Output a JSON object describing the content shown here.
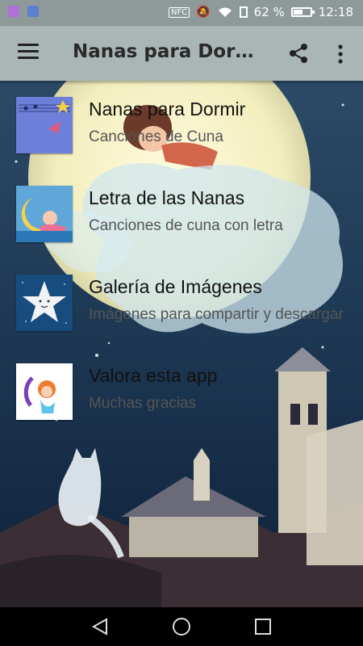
{
  "status_bar": {
    "nfc": "NFC",
    "battery_percent": "62 %",
    "battery_level": 0.62,
    "time": "12:18"
  },
  "app_bar": {
    "title": "Nanas para Dormir...",
    "menu_icon": "hamburger-menu-icon",
    "share_icon": "share-icon",
    "more_icon": "more-vert-icon"
  },
  "menu_items": [
    {
      "title": "Nanas para Dormir",
      "subtitle": "Canciones de Cuna",
      "thumbnail": "music-sheet-thumbnail"
    },
    {
      "title": "Letra de las Nanas",
      "subtitle": "Canciones de cuna con letra",
      "thumbnail": "baby-moon-thumbnail"
    },
    {
      "title": "Galería de Imágenes",
      "subtitle": "Imágenes para compartir y descargar",
      "thumbnail": "star-thumbnail"
    },
    {
      "title": "Valora esta app",
      "subtitle": "Muchas gracias",
      "thumbnail": "girl-moon-thumbnail"
    }
  ],
  "nav_bar": {
    "back_icon": "back-triangle-icon",
    "home_icon": "home-circle-icon",
    "recents_icon": "recents-square-icon"
  },
  "colors": {
    "status_bar": "#8e9a9a",
    "app_bar": "#a9b6b5",
    "night_sky": "#1b3550",
    "moon": "#f6f2c6"
  }
}
